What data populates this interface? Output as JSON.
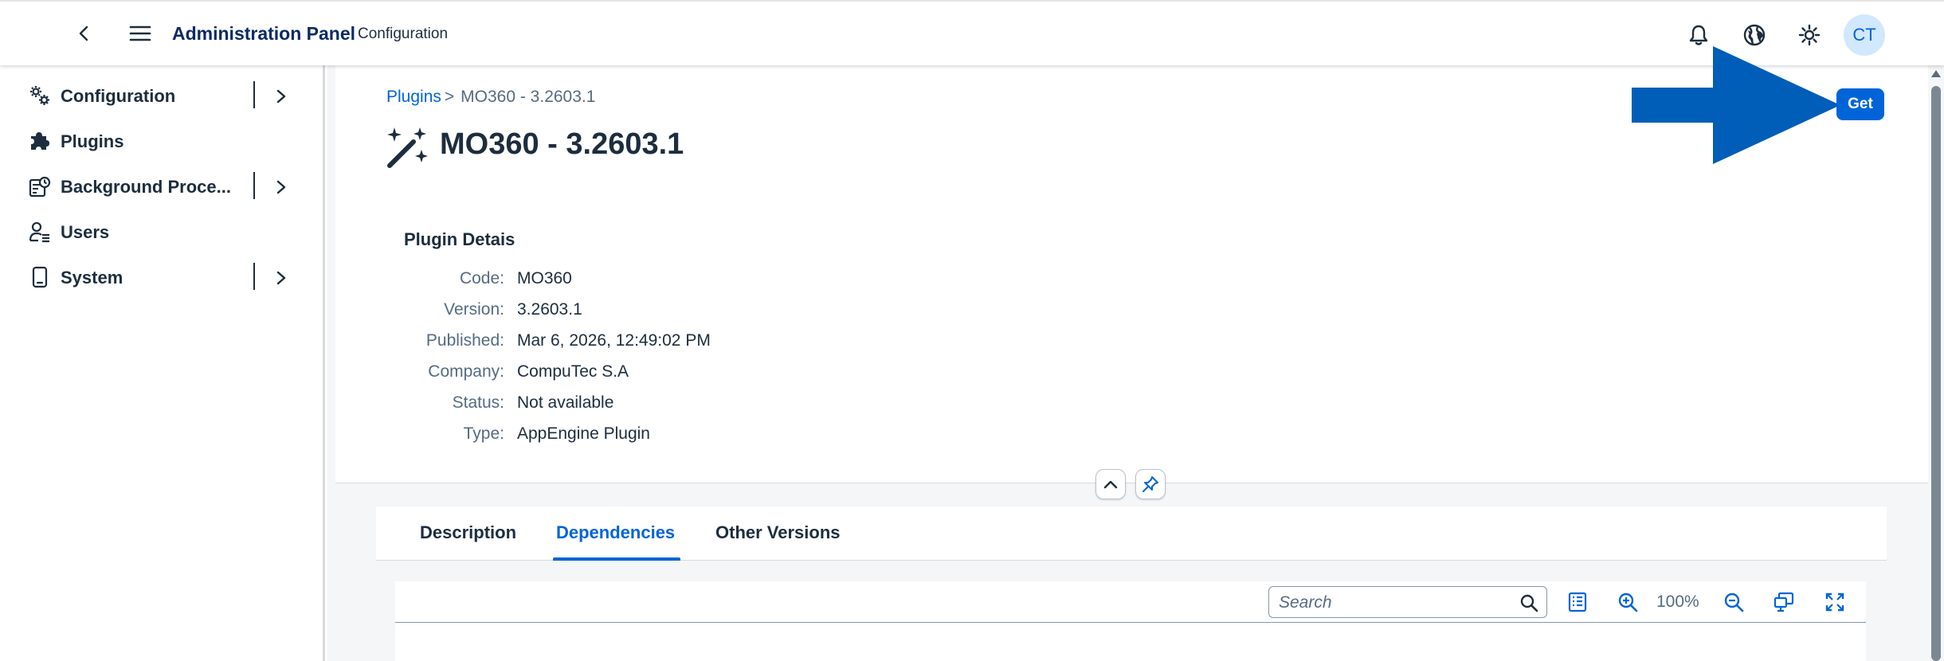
{
  "shell": {
    "app_title": "Administration Panel",
    "app_subtitle": "Configuration",
    "avatar_initials": "CT",
    "icons": [
      "back-icon",
      "menu-icon",
      "bell-icon",
      "globe-icon",
      "sun-icon"
    ]
  },
  "sidebar": {
    "items": [
      {
        "label": "Configuration",
        "icon": "gears-icon",
        "expandable": true
      },
      {
        "label": "Plugins",
        "icon": "puzzle-icon",
        "expandable": false
      },
      {
        "label": "Background Proce...",
        "icon": "process-icon",
        "expandable": true
      },
      {
        "label": "Users",
        "icon": "user-list-icon",
        "expandable": false
      },
      {
        "label": "System",
        "icon": "device-icon",
        "expandable": true
      }
    ]
  },
  "page": {
    "breadcrumb": {
      "link": "Plugins",
      "separator": ">",
      "current": "MO360 - 3.2603.1"
    },
    "title": "MO360 - 3.2603.1",
    "get_button": "Get",
    "details_title": "Plugin Detais",
    "details": [
      {
        "label": "Code:",
        "value": "MO360"
      },
      {
        "label": "Version:",
        "value": "3.2603.1"
      },
      {
        "label": "Published:",
        "value": "Mar 6, 2026, 12:49:02 PM"
      },
      {
        "label": "Company:",
        "value": "CompuTec S.A"
      },
      {
        "label": "Status:",
        "value": "Not available"
      },
      {
        "label": "Type:",
        "value": "AppEngine Plugin"
      }
    ],
    "tabs": [
      {
        "label": "Description",
        "active": false
      },
      {
        "label": "Dependencies",
        "active": true
      },
      {
        "label": "Other Versions",
        "active": false
      }
    ],
    "table_toolbar": {
      "search_placeholder": "Search",
      "zoom": "100%"
    }
  },
  "colors": {
    "accent": "#0064d9",
    "title_blue": "#0a2a66",
    "arrow": "#005eb8",
    "text": "#1d2d3e",
    "muted": "#556b82"
  }
}
